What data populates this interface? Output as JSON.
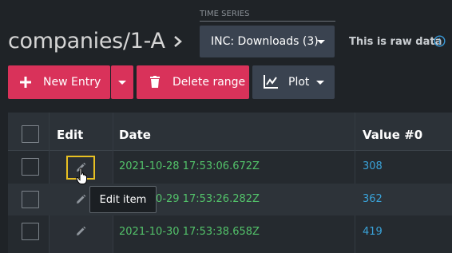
{
  "header": {
    "title": "companies/1-A",
    "time_series_caption": "TIME SERIES",
    "time_series_selected": "INC: Downloads (3)",
    "raw_data_text": "This is raw data"
  },
  "toolbar": {
    "new_entry_label": "New Entry",
    "delete_range_label": "Delete range",
    "plot_label": "Plot"
  },
  "table": {
    "columns": [
      "Edit",
      "Date",
      "Value #0"
    ],
    "rows": [
      {
        "date": "2021-10-28 17:53:06.672Z",
        "value": "308"
      },
      {
        "date": "2021-10-29 17:53:26.282Z",
        "value": "362"
      },
      {
        "date": "2021-10-30 17:53:38.658Z",
        "value": "419"
      }
    ]
  },
  "tooltip": {
    "text": "Edit item"
  },
  "colors": {
    "accent": "#d9325a",
    "date": "#53c26a",
    "value": "#3aa3d9",
    "focus": "#e8c022"
  }
}
